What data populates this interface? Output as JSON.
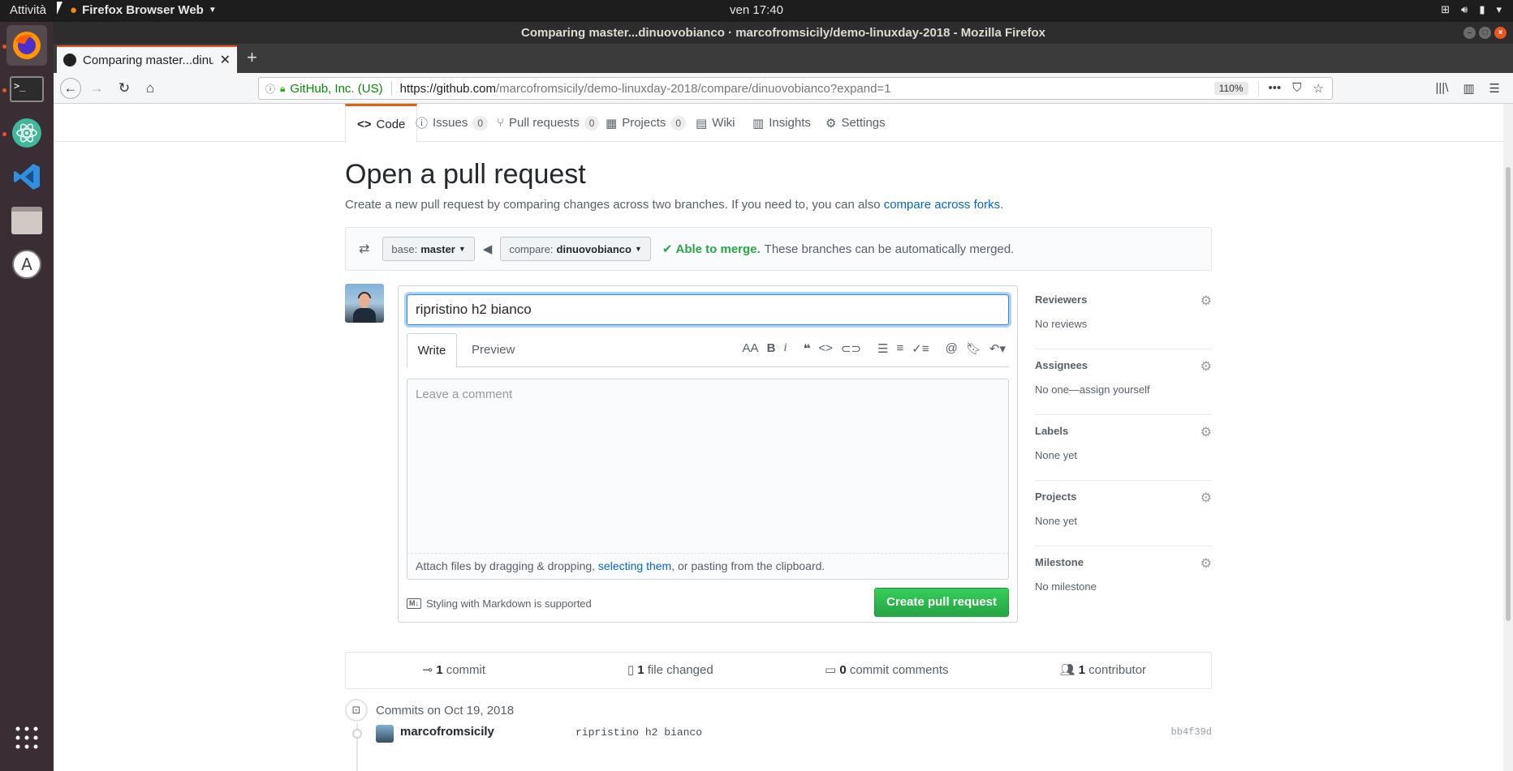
{
  "system": {
    "activities": "Attività",
    "app_menu": "Firefox Browser Web",
    "clock": "ven 17:40"
  },
  "window": {
    "title": "Comparing master...dinuovobianco · marcofromsicily/demo-linuxday-2018 - Mozilla Firefox"
  },
  "browser": {
    "tab_label": "Comparing master...dinuovobianco",
    "identity": "GitHub, Inc. (US)",
    "url_prefix": "https://github.com",
    "url_path": "/marcofromsicily/demo-linuxday-2018/compare/dinuovobianco?expand=1",
    "zoom": "110%"
  },
  "repo_nav": {
    "code": "Code",
    "issues": "Issues",
    "issues_count": "0",
    "pulls": "Pull requests",
    "pulls_count": "0",
    "projects": "Projects",
    "projects_count": "0",
    "wiki": "Wiki",
    "insights": "Insights",
    "settings": "Settings"
  },
  "header": {
    "title": "Open a pull request",
    "subtitle": "Create a new pull request by comparing changes across two branches. If you need to, you can also",
    "compare_link": "compare across forks",
    "period": "."
  },
  "range": {
    "base_prefix": "base:",
    "base_branch": "master",
    "compare_prefix": "compare:",
    "compare_branch": "dinuovobianco",
    "merge_status": "Able to merge.",
    "merge_note": "These branches can be automatically merged."
  },
  "composer": {
    "title_value": "ripristino h2 bianco",
    "tab_write": "Write",
    "tab_preview": "Preview",
    "comment_placeholder": "Leave a comment",
    "attach_prefix": "Attach files by dragging & dropping,",
    "attach_link": "selecting them",
    "attach_suffix": ", or pasting from the clipboard.",
    "markdown_note": "Styling with Markdown is supported",
    "submit": "Create pull request"
  },
  "sidebar": {
    "sections": [
      {
        "label": "Reviewers",
        "value": "No reviews"
      },
      {
        "label": "Assignees",
        "value": "No one—assign yourself"
      },
      {
        "label": "Labels",
        "value": "None yet"
      },
      {
        "label": "Projects",
        "value": "None yet"
      },
      {
        "label": "Milestone",
        "value": "No milestone"
      }
    ]
  },
  "summary": {
    "commits_n": "1",
    "commits_label": "commit",
    "files_n": "1",
    "files_label": "file changed",
    "comments_n": "0",
    "comments_label": "commit comments",
    "contributors_n": "1",
    "contributors_label": "contributor"
  },
  "commits": {
    "date_header": "Commits on Oct 19, 2018",
    "items": [
      {
        "author": "marcofromsicily",
        "message": "ripristino h2 bianco",
        "sha": "bb4f39d"
      }
    ]
  },
  "colors": {
    "accent_tab": "#e36209",
    "primary_button": "#28a745",
    "link": "#0366d6",
    "ubuntu_orange": "#e95420"
  }
}
